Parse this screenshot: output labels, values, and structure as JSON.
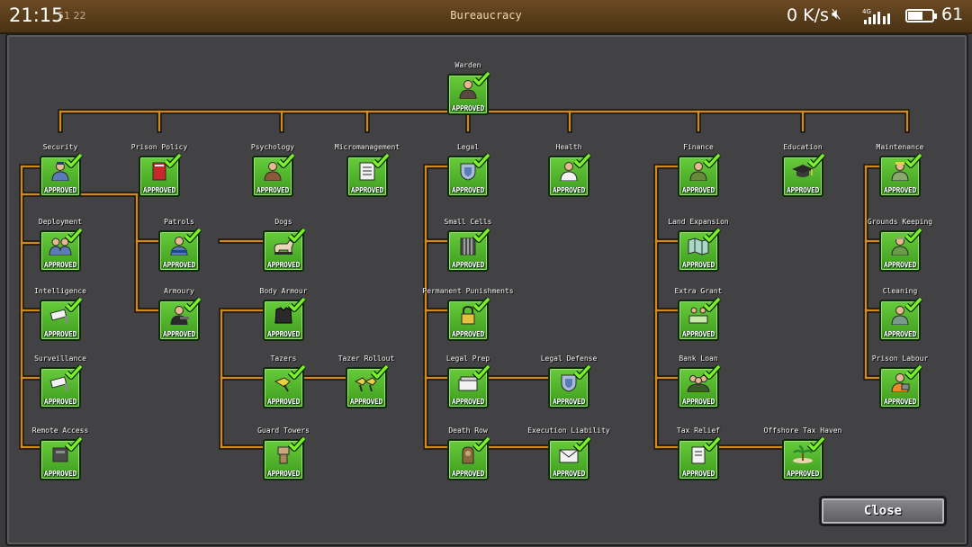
{
  "status_bar": {
    "time": "21:15",
    "faded_text": "51  22",
    "network_speed": "0 K/s",
    "mute_icon": "mute-icon",
    "signal_label": "4G",
    "battery_percent": "61",
    "battery_level": 0.61
  },
  "window": {
    "title": "Bureaucracy"
  },
  "status_label": "APPROVED",
  "colors": {
    "connector": "#d08a1e",
    "tile": "#4cb02a",
    "check": "#7cf02a",
    "panel": "#424244"
  },
  "nodes": [
    {
      "label": "Warden",
      "icon": "warden-icon"
    },
    {
      "label": "Security",
      "icon": "security-icon"
    },
    {
      "label": "Prison Policy",
      "icon": "policy-book-icon"
    },
    {
      "label": "Psychology",
      "icon": "psychologist-icon"
    },
    {
      "label": "Micromanagement",
      "icon": "clipboard-icon"
    },
    {
      "label": "Legal",
      "icon": "legal-shield-icon"
    },
    {
      "label": "Health",
      "icon": "doctor-icon"
    },
    {
      "label": "Finance",
      "icon": "accountant-icon"
    },
    {
      "label": "Education",
      "icon": "graduation-cap-icon"
    },
    {
      "label": "Maintenance",
      "icon": "foreman-icon"
    },
    {
      "label": "Deployment",
      "icon": "guards-icon"
    },
    {
      "label": "Intelligence",
      "icon": "cctv-icon"
    },
    {
      "label": "Surveillance",
      "icon": "camera-icon"
    },
    {
      "label": "Remote Access",
      "icon": "door-panel-icon"
    },
    {
      "label": "Patrols",
      "icon": "patrol-guard-icon"
    },
    {
      "label": "Armoury",
      "icon": "armed-guard-icon"
    },
    {
      "label": "Dogs",
      "icon": "dog-icon"
    },
    {
      "label": "Body Armour",
      "icon": "body-armour-icon"
    },
    {
      "label": "Tazers",
      "icon": "tazer-icon"
    },
    {
      "label": "Tazer Rollout",
      "icon": "tazer-rollout-icon"
    },
    {
      "label": "Guard Towers",
      "icon": "guard-tower-icon"
    },
    {
      "label": "Small Cells",
      "icon": "small-cell-icon"
    },
    {
      "label": "Permanent Punishments",
      "icon": "padlock-icon"
    },
    {
      "label": "Legal Prep",
      "icon": "legal-papers-icon"
    },
    {
      "label": "Legal Defense",
      "icon": "defense-shield-icon"
    },
    {
      "label": "Death Row",
      "icon": "death-row-icon"
    },
    {
      "label": "Execution Liability",
      "icon": "envelope-icon"
    },
    {
      "label": "Land Expansion",
      "icon": "map-icon"
    },
    {
      "label": "Extra Grant",
      "icon": "money-people-icon"
    },
    {
      "label": "Bank Loan",
      "icon": "bankers-icon"
    },
    {
      "label": "Tax Relief",
      "icon": "tax-form-icon"
    },
    {
      "label": "Offshore Tax Haven",
      "icon": "island-icon"
    },
    {
      "label": "Grounds Keeping",
      "icon": "gardener-icon"
    },
    {
      "label": "Cleaning",
      "icon": "janitor-icon"
    },
    {
      "label": "Prison Labour",
      "icon": "labour-icon"
    }
  ],
  "close_button": {
    "label": "Close"
  }
}
